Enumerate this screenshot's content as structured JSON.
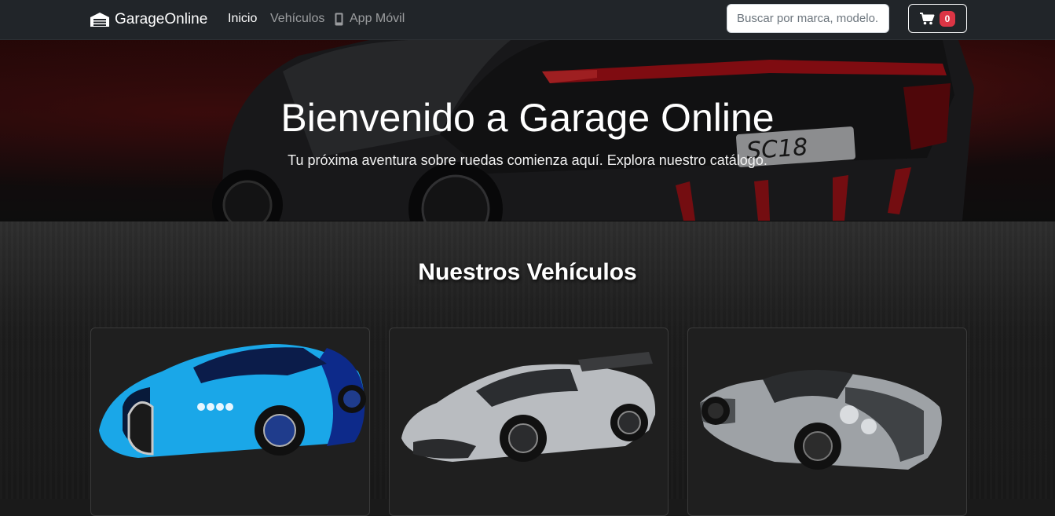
{
  "navbar": {
    "brand": "GarageOnline",
    "links": [
      {
        "label": "Inicio",
        "active": true
      },
      {
        "label": "Vehículos",
        "active": false
      },
      {
        "label": "App Móvil",
        "active": false
      }
    ],
    "search_placeholder": "Buscar por marca, modelo...",
    "cart_count": "0"
  },
  "hero": {
    "title": "Bienvenido a Garage Online",
    "subtitle": "Tu próxima aventura sobre ruedas comienza aquí. Explora nuestro catálogo.",
    "plate_text": "SC18"
  },
  "catalog": {
    "title": "Nuestros Vehículos",
    "cards": [
      {
        "image": "blue-hypercar",
        "color": "#1aa7e8"
      },
      {
        "image": "silver-hypercar",
        "color": "#b9bcc0"
      },
      {
        "image": "silver-carbon-hypercar",
        "color": "#9ea2a6"
      }
    ]
  },
  "colors": {
    "navbar_bg": "#212529",
    "badge": "#dc3545",
    "accent_red": "#c3131b"
  }
}
